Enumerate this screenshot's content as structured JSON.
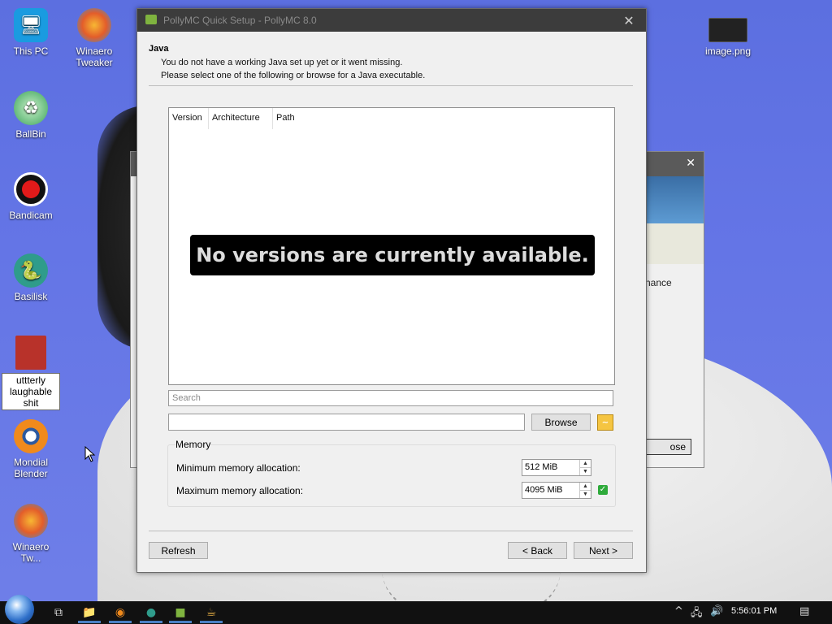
{
  "desktop": {
    "icons": [
      {
        "label": "This PC",
        "name": "desktop-icon-this-pc"
      },
      {
        "label": "Winaero Tweaker",
        "name": "desktop-icon-winaero-tweaker"
      },
      {
        "label": "BallBin",
        "name": "desktop-icon-ballbin"
      },
      {
        "label": "Bandicam",
        "name": "desktop-icon-bandicam"
      },
      {
        "label": "Basilisk",
        "name": "desktop-icon-basilisk"
      },
      {
        "label": "uttterly laughable shit",
        "name": "desktop-icon-uttterly"
      },
      {
        "label": "Mondial Blender",
        "name": "desktop-icon-mondial-blender"
      },
      {
        "label": "Winaero Tw...",
        "name": "desktop-icon-winaero-tw"
      },
      {
        "label": "image.png",
        "name": "desktop-icon-image-png"
      }
    ]
  },
  "back_window": {
    "visible_text": "nance",
    "button_text": "ose"
  },
  "dialog": {
    "title": "PollyMC Quick Setup - PollyMC 8.0",
    "section_heading": "Java",
    "description_line1": "You do not have a working Java set up yet or it went missing.",
    "description_line2": "Please select one of the following or browse for a Java executable.",
    "table_columns": [
      "Version",
      "Architecture",
      "Path"
    ],
    "empty_message": "No versions are currently available.",
    "search_placeholder": "Search",
    "java_path_value": "",
    "browse_label": "Browse",
    "memory": {
      "group_title": "Memory",
      "min_label": "Minimum memory allocation:",
      "min_value": "512 MiB",
      "max_label": "Maximum memory allocation:",
      "max_value": "4095 MiB"
    },
    "refresh_label": "Refresh",
    "back_label": "< Back",
    "next_label": "Next >"
  },
  "taskbar": {
    "clock": "5:56:01 PM"
  }
}
